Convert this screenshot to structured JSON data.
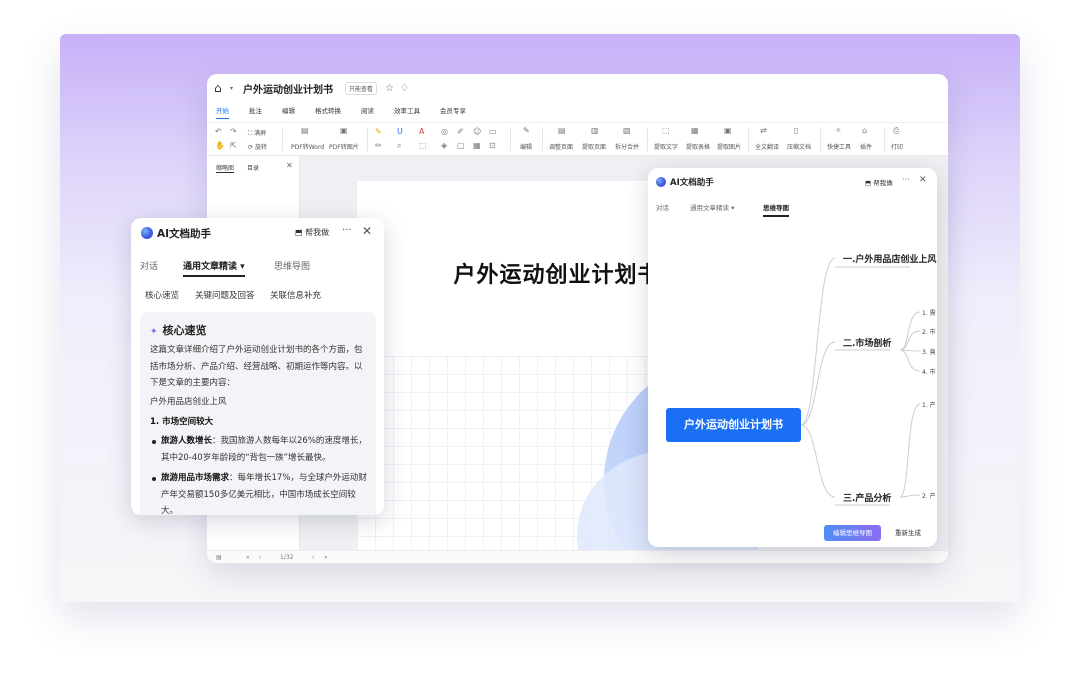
{
  "app": {
    "doc_title": "户外运动创业计划书",
    "read_only": "只能查看",
    "menu": [
      "开始",
      "批注",
      "编辑",
      "格式转换",
      "阅读",
      "效率工具",
      "会员专享"
    ],
    "toolbar": {
      "undo_group": [
        "满屏",
        "旋转"
      ],
      "pdf_to_word": "PDF转Word",
      "pdf_to_image": "PDF转图片",
      "edit": "编辑",
      "adjust_page": "调整页面",
      "extract_page": "提取页面",
      "split_merge": "拆分合并",
      "extract_text": "提取文字",
      "extract_table": "提取表格",
      "extract_image": "提取图片",
      "full_translate": "全文翻译",
      "compress": "压缩文档",
      "quick_tools": "快捷工具",
      "plugins": "插件",
      "print": "打印"
    },
    "sidebar": {
      "tabs": [
        "缩略图",
        "目录"
      ]
    },
    "page": {
      "title": "户外运动创业计划书"
    },
    "status": {
      "page_indicator": "1/32"
    }
  },
  "assistant_left": {
    "title": "AI文档助手",
    "help_btn": "帮我做",
    "tabs": [
      "对话",
      "通用文章精读",
      "思维导图"
    ],
    "chips": [
      "核心速览",
      "关键问题及回答",
      "关联信息补充"
    ],
    "card": {
      "heading": "核心速览",
      "intro": "这篇文章详细介绍了户外运动创业计划书的各个方面，包括市场分析、产品介绍、经营战略、初期运作等内容。以下是文章的主要内容：",
      "subtitle": "户外用品店创业上风",
      "section": "1. 市场空间较大",
      "bullets": [
        {
          "label": "旅游人数增长",
          "text": "：我国旅游人数每年以26%的速度增长，其中20-40岁年龄段的“背包一族”增长最快。"
        },
        {
          "label": "旅游用品市场需求",
          "text": "：每年增长17%，与全球户外运动财产年交易额150多亿美元相比，中国市场成长空间较大。"
        }
      ]
    }
  },
  "assistant_right": {
    "title": "AI文档助手",
    "help_btn": "帮我做",
    "tabs": [
      "对话",
      "通用文章精读",
      "思维导图"
    ],
    "mindmap": {
      "root": "户外运动创业计划书",
      "branches": [
        "一.户外用品店创业上风",
        "二.市场剖析",
        "三.产品分析"
      ],
      "leaves_market": [
        "1. 需",
        "2. 市",
        "3. 竟",
        "4. 市"
      ],
      "leaves_product": [
        "1. 产",
        "2. 产"
      ]
    },
    "buttons": {
      "edit": "编辑思维导图",
      "regen": "重新生成"
    }
  }
}
